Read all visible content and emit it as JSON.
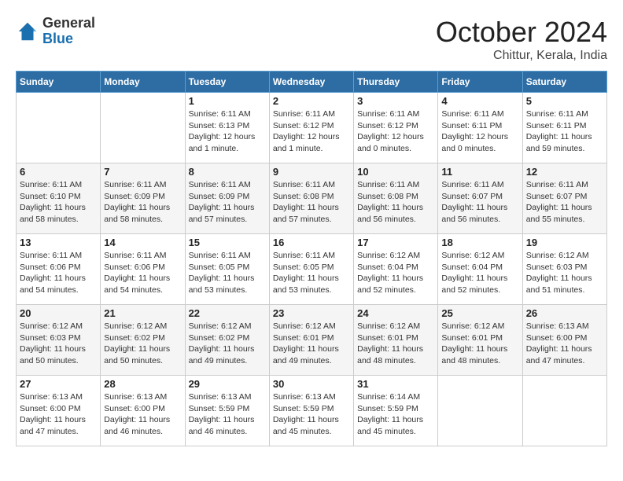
{
  "header": {
    "logo_general": "General",
    "logo_blue": "Blue",
    "month": "October 2024",
    "location": "Chittur, Kerala, India"
  },
  "days_of_week": [
    "Sunday",
    "Monday",
    "Tuesday",
    "Wednesday",
    "Thursday",
    "Friday",
    "Saturday"
  ],
  "weeks": [
    [
      {
        "day": "",
        "info": ""
      },
      {
        "day": "",
        "info": ""
      },
      {
        "day": "1",
        "info": "Sunrise: 6:11 AM\nSunset: 6:13 PM\nDaylight: 12 hours and 1 minute."
      },
      {
        "day": "2",
        "info": "Sunrise: 6:11 AM\nSunset: 6:12 PM\nDaylight: 12 hours and 1 minute."
      },
      {
        "day": "3",
        "info": "Sunrise: 6:11 AM\nSunset: 6:12 PM\nDaylight: 12 hours and 0 minutes."
      },
      {
        "day": "4",
        "info": "Sunrise: 6:11 AM\nSunset: 6:11 PM\nDaylight: 12 hours and 0 minutes."
      },
      {
        "day": "5",
        "info": "Sunrise: 6:11 AM\nSunset: 6:11 PM\nDaylight: 11 hours and 59 minutes."
      }
    ],
    [
      {
        "day": "6",
        "info": "Sunrise: 6:11 AM\nSunset: 6:10 PM\nDaylight: 11 hours and 58 minutes."
      },
      {
        "day": "7",
        "info": "Sunrise: 6:11 AM\nSunset: 6:09 PM\nDaylight: 11 hours and 58 minutes."
      },
      {
        "day": "8",
        "info": "Sunrise: 6:11 AM\nSunset: 6:09 PM\nDaylight: 11 hours and 57 minutes."
      },
      {
        "day": "9",
        "info": "Sunrise: 6:11 AM\nSunset: 6:08 PM\nDaylight: 11 hours and 57 minutes."
      },
      {
        "day": "10",
        "info": "Sunrise: 6:11 AM\nSunset: 6:08 PM\nDaylight: 11 hours and 56 minutes."
      },
      {
        "day": "11",
        "info": "Sunrise: 6:11 AM\nSunset: 6:07 PM\nDaylight: 11 hours and 56 minutes."
      },
      {
        "day": "12",
        "info": "Sunrise: 6:11 AM\nSunset: 6:07 PM\nDaylight: 11 hours and 55 minutes."
      }
    ],
    [
      {
        "day": "13",
        "info": "Sunrise: 6:11 AM\nSunset: 6:06 PM\nDaylight: 11 hours and 54 minutes."
      },
      {
        "day": "14",
        "info": "Sunrise: 6:11 AM\nSunset: 6:06 PM\nDaylight: 11 hours and 54 minutes."
      },
      {
        "day": "15",
        "info": "Sunrise: 6:11 AM\nSunset: 6:05 PM\nDaylight: 11 hours and 53 minutes."
      },
      {
        "day": "16",
        "info": "Sunrise: 6:11 AM\nSunset: 6:05 PM\nDaylight: 11 hours and 53 minutes."
      },
      {
        "day": "17",
        "info": "Sunrise: 6:12 AM\nSunset: 6:04 PM\nDaylight: 11 hours and 52 minutes."
      },
      {
        "day": "18",
        "info": "Sunrise: 6:12 AM\nSunset: 6:04 PM\nDaylight: 11 hours and 52 minutes."
      },
      {
        "day": "19",
        "info": "Sunrise: 6:12 AM\nSunset: 6:03 PM\nDaylight: 11 hours and 51 minutes."
      }
    ],
    [
      {
        "day": "20",
        "info": "Sunrise: 6:12 AM\nSunset: 6:03 PM\nDaylight: 11 hours and 50 minutes."
      },
      {
        "day": "21",
        "info": "Sunrise: 6:12 AM\nSunset: 6:02 PM\nDaylight: 11 hours and 50 minutes."
      },
      {
        "day": "22",
        "info": "Sunrise: 6:12 AM\nSunset: 6:02 PM\nDaylight: 11 hours and 49 minutes."
      },
      {
        "day": "23",
        "info": "Sunrise: 6:12 AM\nSunset: 6:01 PM\nDaylight: 11 hours and 49 minutes."
      },
      {
        "day": "24",
        "info": "Sunrise: 6:12 AM\nSunset: 6:01 PM\nDaylight: 11 hours and 48 minutes."
      },
      {
        "day": "25",
        "info": "Sunrise: 6:12 AM\nSunset: 6:01 PM\nDaylight: 11 hours and 48 minutes."
      },
      {
        "day": "26",
        "info": "Sunrise: 6:13 AM\nSunset: 6:00 PM\nDaylight: 11 hours and 47 minutes."
      }
    ],
    [
      {
        "day": "27",
        "info": "Sunrise: 6:13 AM\nSunset: 6:00 PM\nDaylight: 11 hours and 47 minutes."
      },
      {
        "day": "28",
        "info": "Sunrise: 6:13 AM\nSunset: 6:00 PM\nDaylight: 11 hours and 46 minutes."
      },
      {
        "day": "29",
        "info": "Sunrise: 6:13 AM\nSunset: 5:59 PM\nDaylight: 11 hours and 46 minutes."
      },
      {
        "day": "30",
        "info": "Sunrise: 6:13 AM\nSunset: 5:59 PM\nDaylight: 11 hours and 45 minutes."
      },
      {
        "day": "31",
        "info": "Sunrise: 6:14 AM\nSunset: 5:59 PM\nDaylight: 11 hours and 45 minutes."
      },
      {
        "day": "",
        "info": ""
      },
      {
        "day": "",
        "info": ""
      }
    ]
  ]
}
